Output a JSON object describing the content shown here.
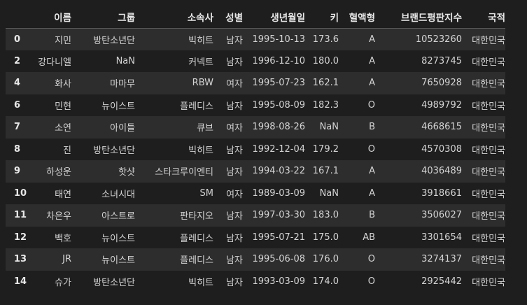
{
  "table": {
    "columns": [
      "이름",
      "그룹",
      "소속사",
      "성별",
      "생년월일",
      "키",
      "혈액형",
      "브랜드평판지수",
      "국적"
    ],
    "rows": [
      {
        "index": "0",
        "cells": [
          "지민",
          "방탄소년단",
          "빅히트",
          "남자",
          "1995-10-13",
          "173.6",
          "A",
          "10523260",
          "대한민국"
        ]
      },
      {
        "index": "2",
        "cells": [
          "강다니엘",
          "NaN",
          "커넥트",
          "남자",
          "1996-12-10",
          "180.0",
          "A",
          "8273745",
          "대한민국"
        ]
      },
      {
        "index": "4",
        "cells": [
          "화사",
          "마마무",
          "RBW",
          "여자",
          "1995-07-23",
          "162.1",
          "A",
          "7650928",
          "대한민국"
        ]
      },
      {
        "index": "6",
        "cells": [
          "민현",
          "뉴이스트",
          "플레디스",
          "남자",
          "1995-08-09",
          "182.3",
          "O",
          "4989792",
          "대한민국"
        ]
      },
      {
        "index": "7",
        "cells": [
          "소연",
          "아이들",
          "큐브",
          "여자",
          "1998-08-26",
          "NaN",
          "B",
          "4668615",
          "대한민국"
        ]
      },
      {
        "index": "8",
        "cells": [
          "진",
          "방탄소년단",
          "빅히트",
          "남자",
          "1992-12-04",
          "179.2",
          "O",
          "4570308",
          "대한민국"
        ]
      },
      {
        "index": "9",
        "cells": [
          "하성운",
          "핫샷",
          "스타크루이엔티",
          "남자",
          "1994-03-22",
          "167.1",
          "A",
          "4036489",
          "대한민국"
        ]
      },
      {
        "index": "10",
        "cells": [
          "태연",
          "소녀시대",
          "SM",
          "여자",
          "1989-03-09",
          "NaN",
          "A",
          "3918661",
          "대한민국"
        ]
      },
      {
        "index": "11",
        "cells": [
          "차은우",
          "아스트로",
          "판타지오",
          "남자",
          "1997-03-30",
          "183.0",
          "B",
          "3506027",
          "대한민국"
        ]
      },
      {
        "index": "12",
        "cells": [
          "백호",
          "뉴이스트",
          "플레디스",
          "남자",
          "1995-07-21",
          "175.0",
          "AB",
          "3301654",
          "대한민국"
        ]
      },
      {
        "index": "13",
        "cells": [
          "JR",
          "뉴이스트",
          "플레디스",
          "남자",
          "1995-06-08",
          "176.0",
          "O",
          "3274137",
          "대한민국"
        ]
      },
      {
        "index": "14",
        "cells": [
          "슈가",
          "방탄소년단",
          "빅히트",
          "남자",
          "1993-03-09",
          "174.0",
          "O",
          "2925442",
          "대한민국"
        ]
      }
    ]
  },
  "colors": {
    "background": "#1e1e1e",
    "row_stripe": "#2d2d2d",
    "text": "#d4d4d4",
    "header_text": "#e8e8e8",
    "header_rule": "#5a5a5a"
  }
}
